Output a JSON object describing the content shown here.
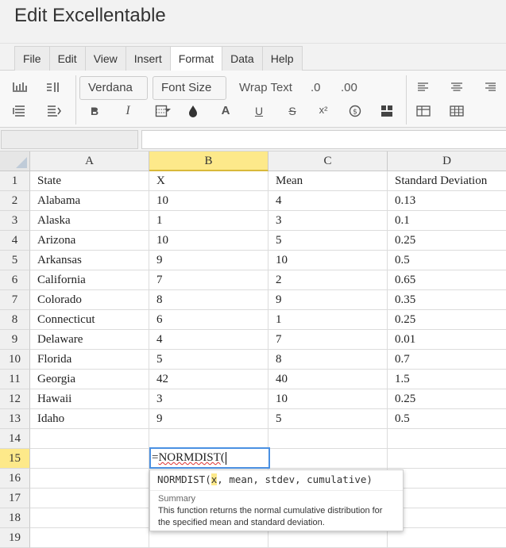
{
  "app": {
    "title": "Edit Excellentable"
  },
  "menu": {
    "tabs": [
      {
        "label": "File"
      },
      {
        "label": "Edit"
      },
      {
        "label": "View"
      },
      {
        "label": "Insert"
      },
      {
        "label": "Format",
        "active": true
      },
      {
        "label": "Data"
      },
      {
        "label": "Help"
      }
    ]
  },
  "toolbar": {
    "font_family": "Verdana",
    "font_size": "Font Size",
    "wrap_text": "Wrap Text",
    "decrease_decimal": ".0",
    "increase_decimal": ".00",
    "bold": "B",
    "italic": "I",
    "font_color": "A",
    "underline": "U",
    "strike": "S",
    "superscript": "x²"
  },
  "formula_bar": {
    "cell_ref": "",
    "content": ""
  },
  "sheet": {
    "columns": [
      "A",
      "B",
      "C",
      "D"
    ],
    "active_column": "B",
    "active_row": 15,
    "rows": [
      {
        "n": "1",
        "cells": [
          "State",
          "X",
          "Mean",
          "Standard Deviation"
        ]
      },
      {
        "n": "2",
        "cells": [
          "Alabama",
          "10",
          "4",
          "0.13"
        ]
      },
      {
        "n": "3",
        "cells": [
          "Alaska",
          "1",
          "3",
          "0.1"
        ]
      },
      {
        "n": "4",
        "cells": [
          "Arizona",
          "10",
          "5",
          "0.25"
        ]
      },
      {
        "n": "5",
        "cells": [
          "Arkansas",
          "9",
          "10",
          "0.5"
        ]
      },
      {
        "n": "6",
        "cells": [
          "California",
          "7",
          "2",
          "0.65"
        ]
      },
      {
        "n": "7",
        "cells": [
          "Colorado",
          "8",
          "9",
          "0.35"
        ]
      },
      {
        "n": "8",
        "cells": [
          "Connecticut",
          "6",
          "1",
          "0.25"
        ]
      },
      {
        "n": "9",
        "cells": [
          "Delaware",
          "4",
          "7",
          "0.01"
        ]
      },
      {
        "n": "10",
        "cells": [
          "Florida",
          "5",
          "8",
          "0.7"
        ]
      },
      {
        "n": "11",
        "cells": [
          "Georgia",
          "42",
          "40",
          "1.5"
        ]
      },
      {
        "n": "12",
        "cells": [
          "Hawaii",
          "3",
          "10",
          "0.25"
        ]
      },
      {
        "n": "13",
        "cells": [
          "Idaho",
          "9",
          "5",
          "0.5"
        ]
      },
      {
        "n": "14",
        "cells": [
          "",
          "",
          "",
          ""
        ]
      },
      {
        "n": "15",
        "cells": [
          "",
          "",
          "",
          ""
        ]
      },
      {
        "n": "16",
        "cells": [
          "",
          "",
          "",
          ""
        ]
      },
      {
        "n": "17",
        "cells": [
          "",
          "",
          "",
          ""
        ]
      },
      {
        "n": "18",
        "cells": [
          "",
          "",
          "",
          ""
        ]
      },
      {
        "n": "19",
        "cells": [
          "",
          "",
          "",
          ""
        ]
      }
    ]
  },
  "editor": {
    "prefix": "=",
    "function_name": "NORMDIST",
    "suffix": "("
  },
  "tooltip": {
    "sig_fn": "NORMDIST(",
    "sig_arg_active": "x",
    "sig_rest": ", mean, stdev, cumulative)",
    "summary_label": "Summary",
    "description": "This function returns the normal cumulative distribution for the specified mean and standard deviation."
  },
  "colors": {
    "active_header": "#fde98a",
    "editor_border": "#4a90e2",
    "misspell_underline": "#dd3333"
  },
  "icons": [
    "insert-row-above-icon",
    "insert-column-right-icon",
    "insert-row-below-icon",
    "insert-column-left-icon",
    "border-icon",
    "fill-color-icon",
    "currency-icon",
    "merge-cells-icon",
    "align-left-icon",
    "align-center-icon",
    "align-right-icon",
    "table-icon",
    "grid-icon"
  ]
}
